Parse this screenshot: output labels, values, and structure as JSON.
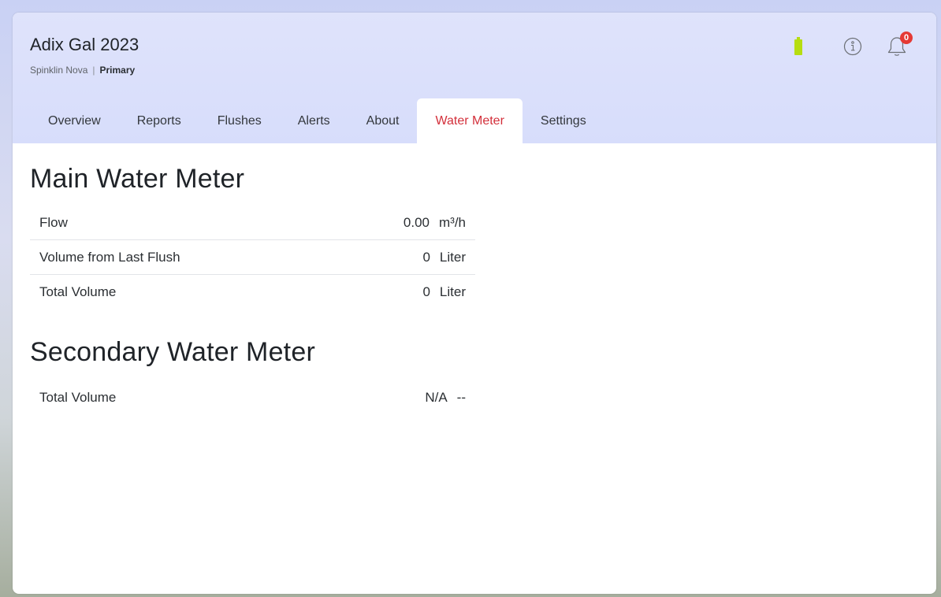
{
  "header": {
    "title": "Adix Gal 2023",
    "subtitle_name": "Spinklin Nova",
    "subtitle_separator": "|",
    "subtitle_role": "Primary",
    "battery_color": "#b6dd10",
    "notification_count": "0"
  },
  "tabs": [
    {
      "label": "Overview"
    },
    {
      "label": "Reports"
    },
    {
      "label": "Flushes"
    },
    {
      "label": "Alerts"
    },
    {
      "label": "About"
    },
    {
      "label": "Water Meter",
      "active": true
    },
    {
      "label": "Settings"
    }
  ],
  "main_meter": {
    "title": "Main Water Meter",
    "rows": [
      {
        "label": "Flow",
        "value": "0.00",
        "unit": "m³/h"
      },
      {
        "label": "Volume from Last Flush",
        "value": "0",
        "unit": "Liter"
      },
      {
        "label": "Total Volume",
        "value": "0",
        "unit": "Liter"
      }
    ]
  },
  "secondary_meter": {
    "title": "Secondary Water Meter",
    "rows": [
      {
        "label": "Total Volume",
        "value": "N/A",
        "unit": "--"
      }
    ]
  },
  "colors": {
    "accent": "#d32f3a",
    "badge": "#e53935"
  }
}
